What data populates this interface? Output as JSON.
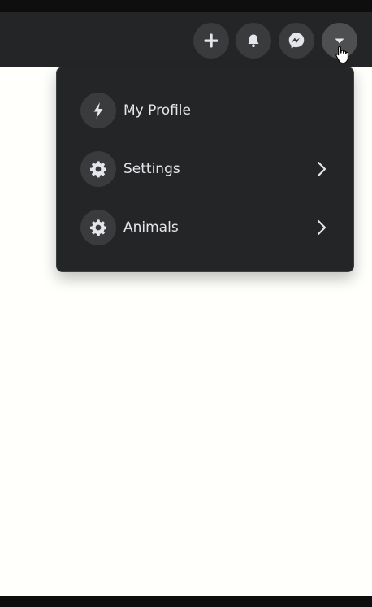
{
  "header": {
    "buttons": [
      {
        "name": "create-button",
        "icon": "plus-icon"
      },
      {
        "name": "notifications-button",
        "icon": "bell-icon"
      },
      {
        "name": "messenger-button",
        "icon": "messenger-icon"
      },
      {
        "name": "account-menu-button",
        "icon": "caret-down-icon"
      }
    ]
  },
  "dropdown": {
    "items": [
      {
        "label": "My Profile",
        "icon": "bolt-icon",
        "has_submenu": false
      },
      {
        "label": "Settings",
        "icon": "gear-icon",
        "has_submenu": true
      },
      {
        "label": "Animals",
        "icon": "gear-icon",
        "has_submenu": true
      }
    ]
  },
  "colors": {
    "navbar_bg": "#242526",
    "button_bg": "#3a3b3c",
    "dropdown_bg": "#242526",
    "text": "#e4e6eb",
    "page_bg": "#fffffc"
  }
}
